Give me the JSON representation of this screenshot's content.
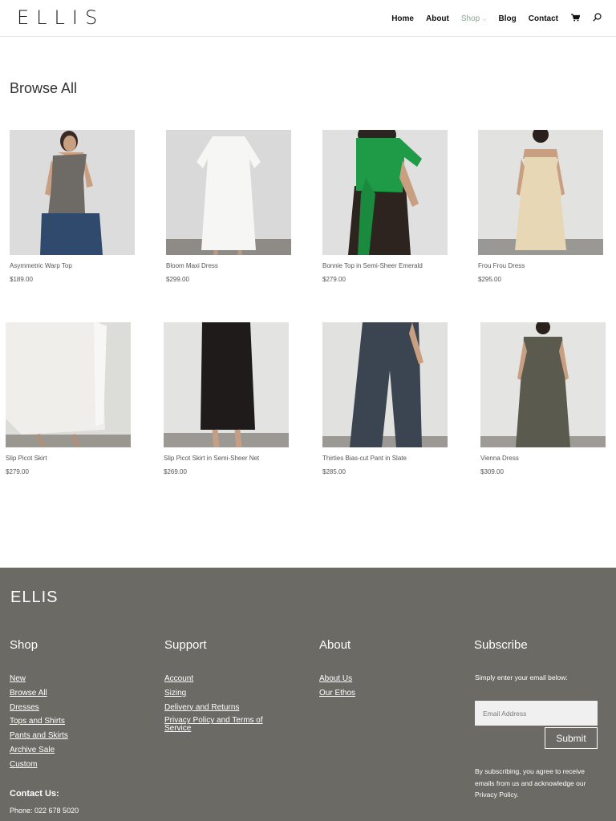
{
  "header": {
    "logo": "ELLIS",
    "nav": [
      "Home",
      "About",
      "Shop",
      "Blog",
      "Contact"
    ],
    "active_nav": "Shop"
  },
  "main": {
    "title": "Browse All",
    "products": [
      {
        "name": "Asymmetric Warp Top",
        "price": "$189.00",
        "image": "grey one-shoulder top"
      },
      {
        "name": "Bloom Maxi Dress",
        "price": "$299.00",
        "image": "white maxi dress"
      },
      {
        "name": "Bonnie Top in Semi-Sheer Emerald",
        "price": "$279.00",
        "image": "emerald wrap top"
      },
      {
        "name": "Frou Frou Dress",
        "price": "$295.00",
        "image": "cream slip dress"
      },
      {
        "name": "Slip Picot Skirt",
        "price": "$279.00",
        "image": "ivory slip skirt"
      },
      {
        "name": "Slip Picot Skirt in Semi-Sheer Net",
        "price": "$269.00",
        "image": "black sheer skirt"
      },
      {
        "name": "Thirties Bias-cut Pant in Slate",
        "price": "$285.00",
        "image": "slate pants"
      },
      {
        "name": "Vienna Dress",
        "price": "$309.00",
        "image": "olive dress"
      }
    ]
  },
  "footer": {
    "logo": "ELLIS",
    "shop": {
      "title": "Shop",
      "links": [
        "New",
        "Browse All",
        "Dresses",
        "Tops and Shirts",
        "Pants and Skirts",
        "Archive Sale",
        "Custom"
      ]
    },
    "support": {
      "title": "Support",
      "links": [
        "Account",
        "Sizing",
        "Delivery and Returns",
        "Privacy Policy and Terms of Service"
      ]
    },
    "about": {
      "title": "About",
      "links": [
        "About Us",
        "Our Ethos"
      ]
    },
    "subscribe": {
      "title": "Subscribe",
      "description": "Simply enter your email below:",
      "placeholder": "Email Address",
      "button": "Submit",
      "note": "By subscribing, you agree to receive emails from us and acknowledge our Privacy Policy."
    },
    "contact": {
      "title": "Contact Us:",
      "phone": "Phone: 022 678 5020"
    }
  },
  "colors": {
    "footer_bg": "#6b6a64",
    "nav_active": "#8aa596"
  }
}
